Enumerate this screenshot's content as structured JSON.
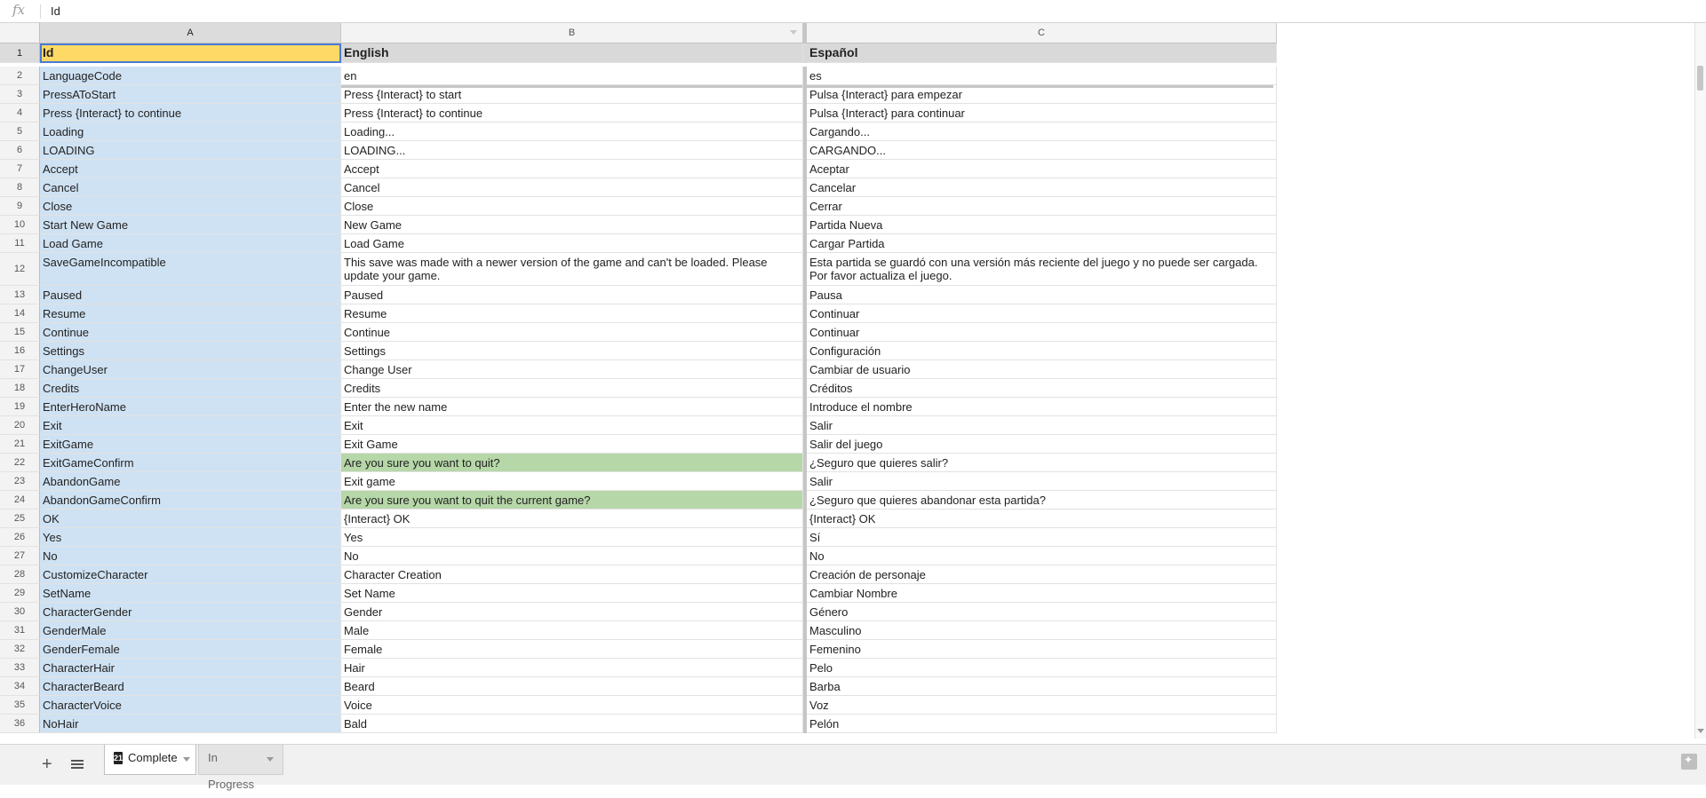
{
  "formula_bar": {
    "fx_label": "fx",
    "content": "Id"
  },
  "columns": [
    {
      "letter": "A",
      "selected": true
    },
    {
      "letter": "B",
      "selected": false,
      "filter": true
    },
    {
      "letter": "C",
      "selected": false
    }
  ],
  "header_row": {
    "num": "1",
    "a": "Id",
    "b": "English",
    "c": "Español"
  },
  "rows": [
    {
      "num": "2",
      "a": "LanguageCode",
      "b": "en",
      "c": "es"
    },
    {
      "num": "3",
      "a": "PressAToStart",
      "b": "Press {Interact} to start",
      "c": "Pulsa {Interact} para empezar"
    },
    {
      "num": "4",
      "a": "Press {Interact} to continue",
      "b": "Press {Interact} to continue",
      "c": "Pulsa {Interact} para continuar"
    },
    {
      "num": "5",
      "a": "Loading",
      "b": "Loading...",
      "c": "Cargando..."
    },
    {
      "num": "6",
      "a": "LOADING",
      "b": "LOADING...",
      "c": "CARGANDO..."
    },
    {
      "num": "7",
      "a": "Accept",
      "b": "Accept",
      "c": "Aceptar"
    },
    {
      "num": "8",
      "a": "Cancel",
      "b": "Cancel",
      "c": "Cancelar"
    },
    {
      "num": "9",
      "a": "Close",
      "b": "Close",
      "c": "Cerrar"
    },
    {
      "num": "10",
      "a": "Start New Game",
      "b": "New Game",
      "c": "Partida Nueva"
    },
    {
      "num": "11",
      "a": "Load Game",
      "b": "Load Game",
      "c": "Cargar Partida"
    },
    {
      "num": "12",
      "a": "SaveGameIncompatible",
      "b": "This save was made with a newer version of the game and can't be loaded. Please update your game.",
      "c": "Esta partida se guardó con una versión más reciente del juego y no puede ser cargada. Por favor actualiza el juego.",
      "tall": true
    },
    {
      "num": "13",
      "a": "Paused",
      "b": "Paused",
      "c": "Pausa"
    },
    {
      "num": "14",
      "a": "Resume",
      "b": "Resume",
      "c": "Continuar"
    },
    {
      "num": "15",
      "a": "Continue",
      "b": "Continue",
      "c": "Continuar"
    },
    {
      "num": "16",
      "a": "Settings",
      "b": "Settings",
      "c": "Configuración"
    },
    {
      "num": "17",
      "a": "ChangeUser",
      "b": "Change User",
      "c": "Cambiar de usuario"
    },
    {
      "num": "18",
      "a": "Credits",
      "b": "Credits",
      "c": "Créditos"
    },
    {
      "num": "19",
      "a": "EnterHeroName",
      "b": "Enter the new name",
      "c": "Introduce el nombre"
    },
    {
      "num": "20",
      "a": "Exit",
      "b": "Exit",
      "c": "Salir"
    },
    {
      "num": "21",
      "a": "ExitGame",
      "b": "Exit Game",
      "c": "Salir del juego"
    },
    {
      "num": "22",
      "a": "ExitGameConfirm",
      "b": "Are you sure you want to quit?",
      "c": "¿Seguro que quieres salir?",
      "highlight_b": true
    },
    {
      "num": "23",
      "a": "AbandonGame",
      "b": "Exit game",
      "c": "Salir"
    },
    {
      "num": "24",
      "a": "AbandonGameConfirm",
      "b": "Are you sure you want to quit the current game?",
      "c": "¿Seguro que quieres abandonar esta partida?",
      "highlight_b": true
    },
    {
      "num": "25",
      "a": "OK",
      "b": "{Interact} OK",
      "c": "{Interact} OK"
    },
    {
      "num": "26",
      "a": "Yes",
      "b": "Yes",
      "c": "Sí"
    },
    {
      "num": "27",
      "a": "No",
      "b": "No",
      "c": "No"
    },
    {
      "num": "28",
      "a": "CustomizeCharacter",
      "b": "Character Creation",
      "c": "Creación de personaje"
    },
    {
      "num": "29",
      "a": "SetName",
      "b": "Set Name",
      "c": "Cambiar Nombre"
    },
    {
      "num": "30",
      "a": "CharacterGender",
      "b": "Gender",
      "c": "Género"
    },
    {
      "num": "31",
      "a": "GenderMale",
      "b": "Male",
      "c": "Masculino"
    },
    {
      "num": "32",
      "a": "GenderFemale",
      "b": "Female",
      "c": "Femenino"
    },
    {
      "num": "33",
      "a": "CharacterHair",
      "b": "Hair",
      "c": "Pelo"
    },
    {
      "num": "34",
      "a": "CharacterBeard",
      "b": "Beard",
      "c": "Barba"
    },
    {
      "num": "35",
      "a": "CharacterVoice",
      "b": "Voice",
      "c": "Voz"
    },
    {
      "num": "36",
      "a": "NoHair",
      "b": "Bald",
      "c": "Pelón"
    }
  ],
  "sheet_tabs": [
    {
      "label": "Complete",
      "active": true,
      "icon_text": "21"
    },
    {
      "label": "In Progress",
      "active": false
    }
  ],
  "colors": {
    "id_column": "#cfe2f3",
    "header_row": "#d9d9d9",
    "active_cell": "#ffd966",
    "highlight": "#b6d7a8"
  }
}
